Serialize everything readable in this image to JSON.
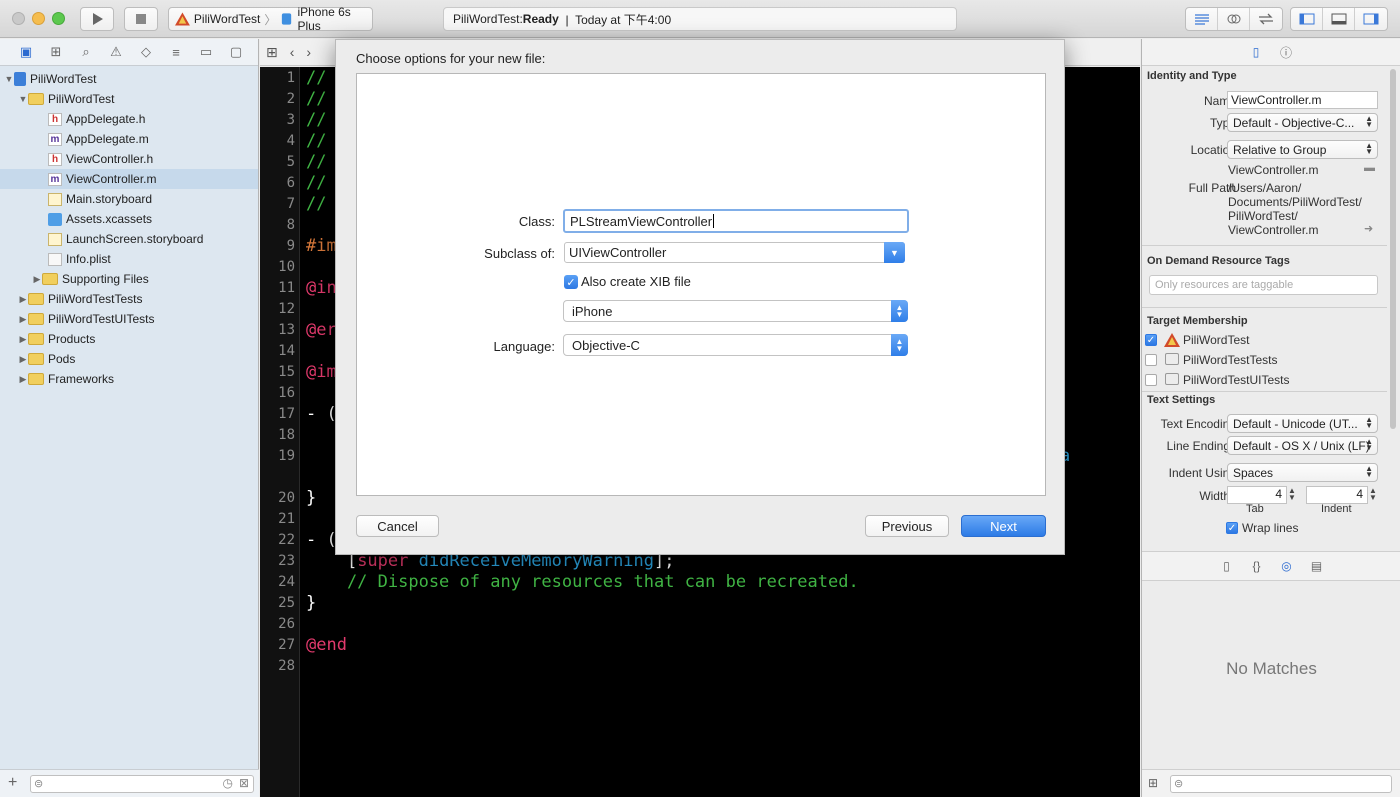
{
  "toolbar": {
    "scheme_name": "PiliWordTest",
    "device_name": "iPhone 6s Plus",
    "activity_project": "PiliWordTest: ",
    "activity_status": "Ready",
    "activity_time": "  |  Today at 下午4:00"
  },
  "navigator": {
    "items": [
      {
        "label": "PiliWordTest",
        "type": "project"
      },
      {
        "label": "PiliWordTest",
        "type": "folder"
      },
      {
        "label": "AppDelegate.h",
        "type": "h"
      },
      {
        "label": "AppDelegate.m",
        "type": "m"
      },
      {
        "label": "ViewController.h",
        "type": "h"
      },
      {
        "label": "ViewController.m",
        "type": "m"
      },
      {
        "label": "Main.storyboard",
        "type": "storyboard"
      },
      {
        "label": "Assets.xcassets",
        "type": "xcassets"
      },
      {
        "label": "LaunchScreen.storyboard",
        "type": "storyboard"
      },
      {
        "label": "Info.plist",
        "type": "plist"
      },
      {
        "label": "Supporting Files",
        "type": "folder"
      },
      {
        "label": "PiliWordTestTests",
        "type": "folder"
      },
      {
        "label": "PiliWordTestUITests",
        "type": "folder"
      },
      {
        "label": "Products",
        "type": "folder"
      },
      {
        "label": "Pods",
        "type": "folder"
      },
      {
        "label": "Frameworks",
        "type": "folder"
      }
    ]
  },
  "editor": {
    "line_numbers": [
      "1",
      "2",
      "3",
      "4",
      "5",
      "6",
      "7",
      "8",
      "9",
      "10",
      "11",
      "12",
      "13",
      "14",
      "15",
      "16",
      "17",
      "18",
      "19",
      "20",
      "21",
      "22",
      "23",
      "24",
      "25",
      "26",
      "27",
      "28"
    ],
    "code": {
      "l1": "//",
      "l2": "//",
      "l3": "//",
      "l4": "//",
      "l5": "//",
      "l6": "//",
      "l7": "//",
      "l9": "#im",
      "l11": "@in",
      "l13": "@er",
      "l15": "@im",
      "l17": "- (",
      "l19_tail": "a",
      "l20": "}",
      "l22": "- (",
      "l23_a": "    [",
      "l23_super": "super",
      "l23_meth": " didReceiveMemoryWarning",
      "l23_b": "];",
      "l24": "    // Dispose of any resources that can be recreated.",
      "l25": "}",
      "l27": "@end"
    }
  },
  "dialog": {
    "title": "Choose options for your new file:",
    "class_label": "Class:",
    "class_value": "PLStreamViewController",
    "subclass_label": "Subclass of:",
    "subclass_value": "UIViewController",
    "xib_label": "Also create XIB file",
    "device_value": "iPhone",
    "language_label": "Language:",
    "language_value": "Objective-C",
    "cancel_label": "Cancel",
    "previous_label": "Previous",
    "next_label": "Next"
  },
  "inspector": {
    "identity_title": "Identity and Type",
    "name_label": "Name",
    "name_value": "ViewController.m",
    "type_label": "Type",
    "type_value": "Default - Objective-C...",
    "location_label": "Location",
    "location_value": "Relative to Group",
    "location_file": "ViewController.m",
    "fullpath_label": "Full Path",
    "fullpath_lines": [
      "/Users/Aaron/",
      "Documents/PiliWordTest/",
      "PiliWordTest/",
      "ViewController.m"
    ],
    "odr_title": "On Demand Resource Tags",
    "odr_placeholder": "Only resources are taggable",
    "target_title": "Target Membership",
    "targets": [
      "PiliWordTest",
      "PiliWordTestTests",
      "PiliWordTestUITests"
    ],
    "text_settings_title": "Text Settings",
    "encoding_label": "Text Encoding",
    "encoding_value": "Default - Unicode (UT...",
    "endings_label": "Line Endings",
    "endings_value": "Default - OS X / Unix (LF)",
    "indent_label": "Indent Using",
    "indent_value": "Spaces",
    "widths_label": "Widths",
    "tab_value": "4",
    "indent_width_value": "4",
    "tab_caption": "Tab",
    "indent_caption": "Indent",
    "wrap_label": "Wrap lines",
    "no_matches": "No Matches"
  }
}
